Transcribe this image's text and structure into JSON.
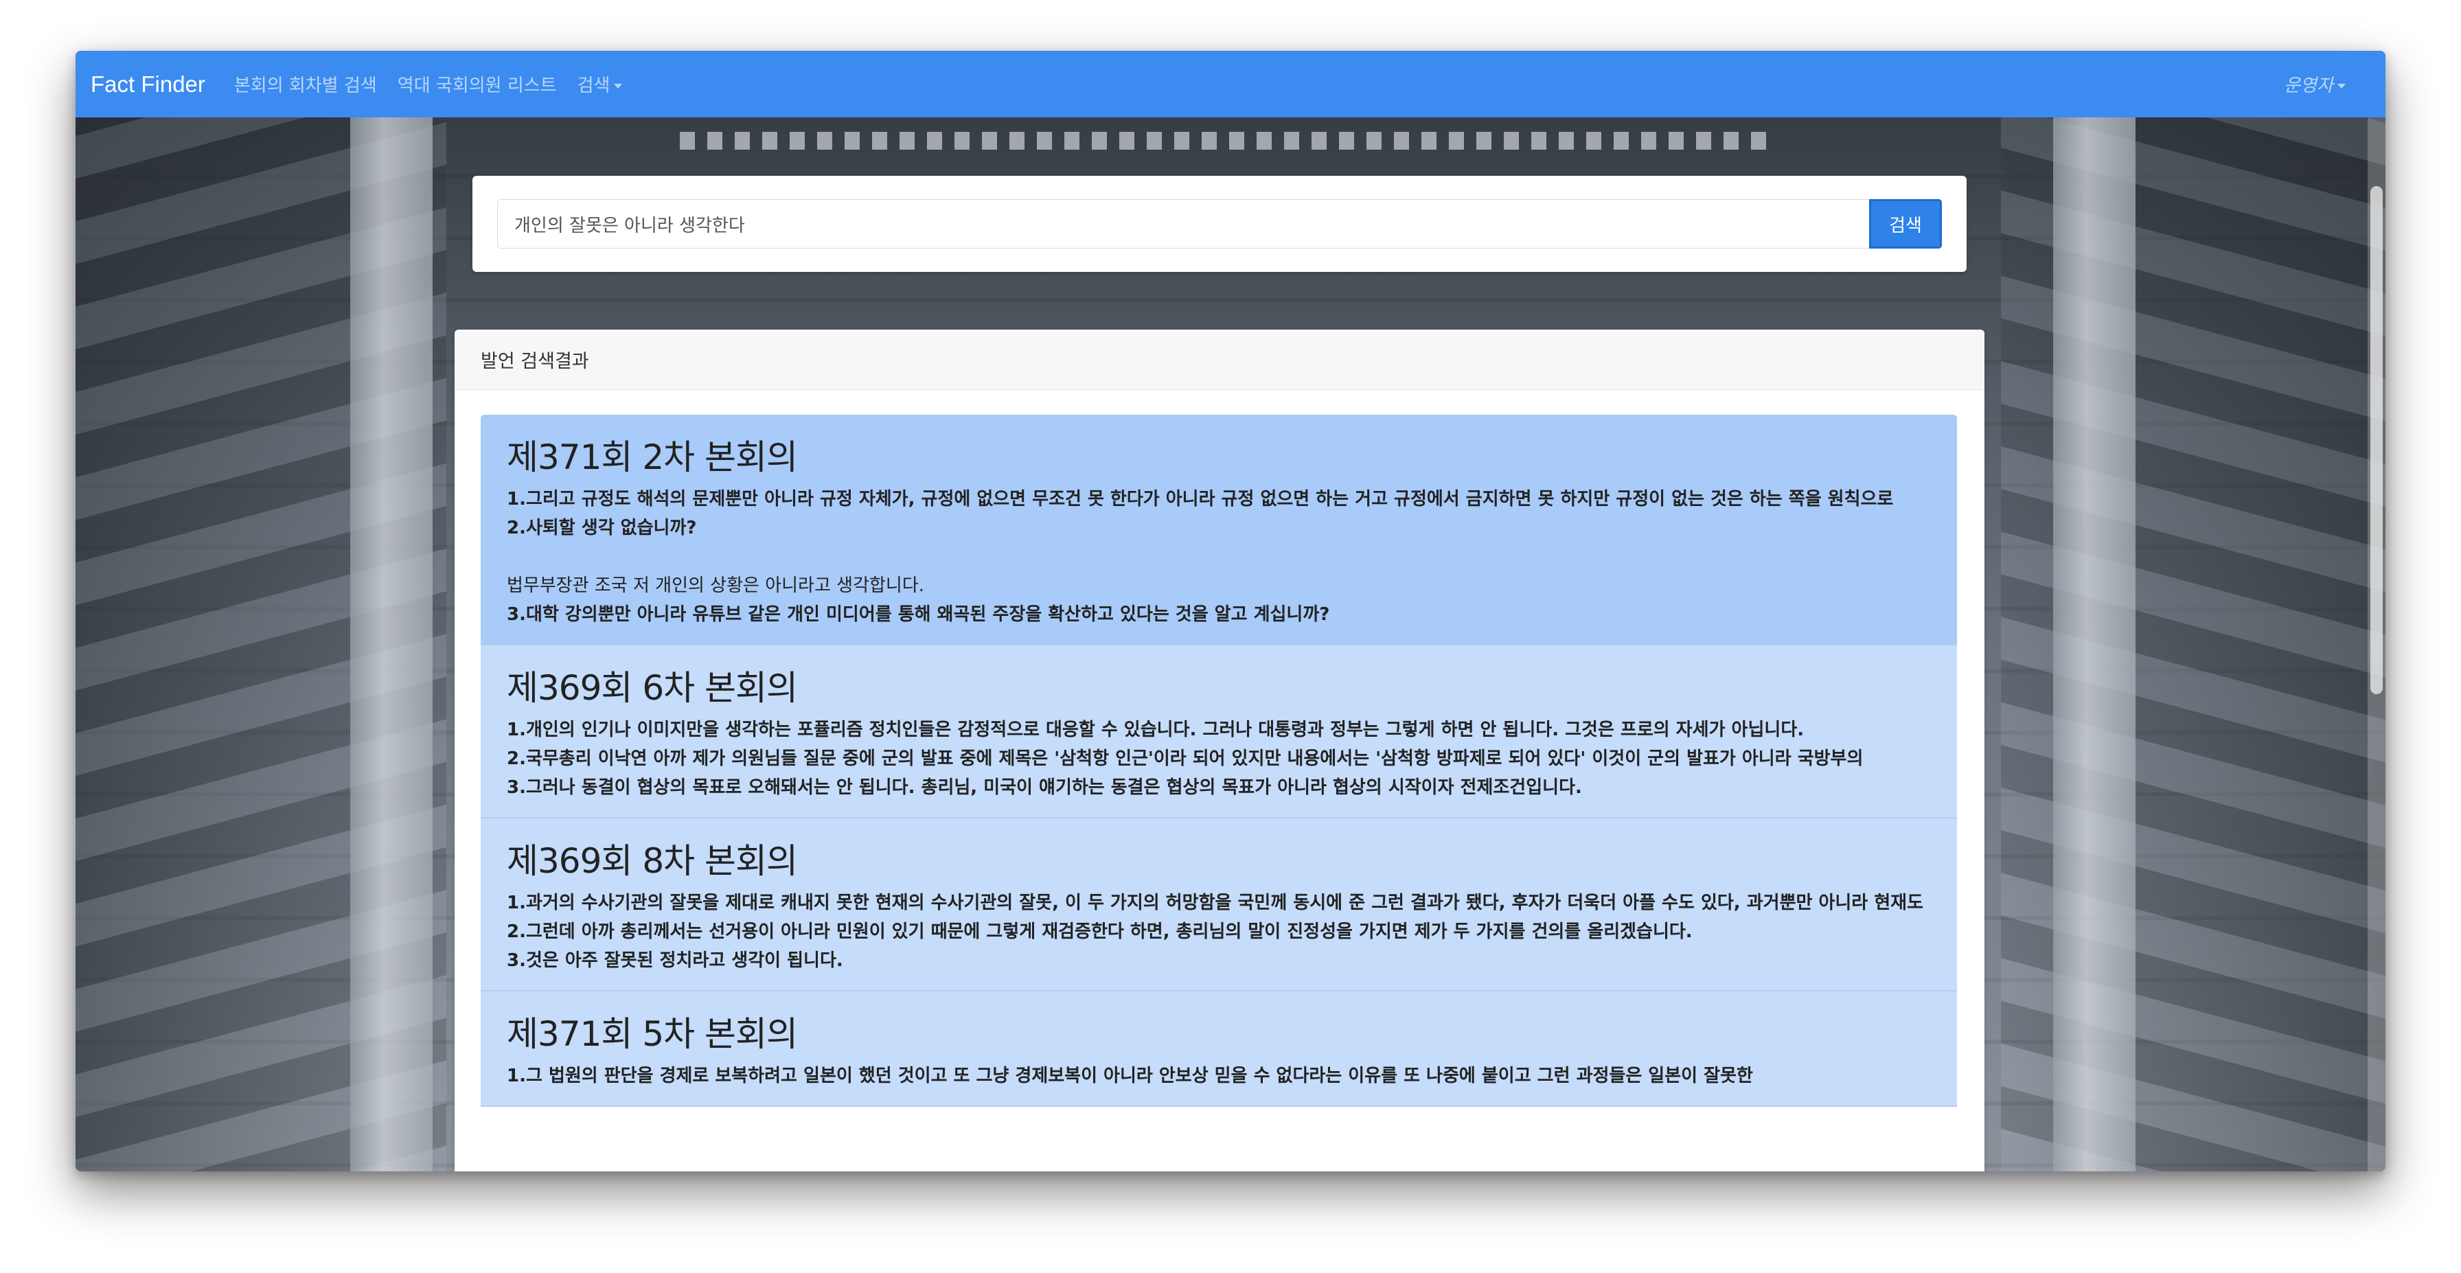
{
  "navbar": {
    "brand": "Fact Finder",
    "links": [
      "본회의 회차별 검색",
      "역대 국회의원 리스트",
      "검색"
    ],
    "user": "운영자"
  },
  "search": {
    "value": "개인의 잘못은 아니라 생각한다",
    "button_label": "검색"
  },
  "results": {
    "header": "발언 검색결과",
    "items": [
      {
        "title": "제371회 2차 본회의",
        "lines": [
          {
            "text": "1.그리고 규정도 해석의 문제뿐만 아니라 규정 자체가, 규정에 없으면 무조건 못 한다가 아니라 규정 없으면 하는 거고 규정에서 금지하면 못 하지만 규정이 없는 것은 하는 쪽을 원칙으로",
            "bold": true
          },
          {
            "text": "2.사퇴할 생각 없습니까?",
            "bold": true
          },
          {
            "text": "",
            "bold": false
          },
          {
            "text": "법무부장관 조국 저 개인의 상황은 아니라고 생각합니다.",
            "bold": false
          },
          {
            "text": "3.대학 강의뿐만 아니라 유튜브 같은 개인 미디어를 통해 왜곡된 주장을 확산하고 있다는 것을 알고 계십니까?",
            "bold": true
          }
        ]
      },
      {
        "title": "제369회 6차 본회의",
        "lines": [
          {
            "text": "1.개인의 인기나 이미지만을 생각하는 포퓰리즘 정치인들은 감정적으로 대응할 수 있습니다. 그러나 대통령과 정부는 그렇게 하면 안 됩니다. 그것은 프로의 자세가 아닙니다.",
            "bold": true
          },
          {
            "text": "2.국무총리 이낙연 아까 제가 의원님들 질문 중에 군의 발표 중에 제목은 '삼척항 인근'이라 되어 있지만 내용에서는 '삼척항 방파제로 되어 있다' 이것이 군의 발표가 아니라 국방부의",
            "bold": true
          },
          {
            "text": "3.그러나 동결이 협상의 목표로 오해돼서는 안 됩니다. 총리님, 미국이 얘기하는 동결은 협상의 목표가 아니라 협상의 시작이자 전제조건입니다.",
            "bold": true
          }
        ]
      },
      {
        "title": "제369회 8차 본회의",
        "lines": [
          {
            "text": "1.과거의 수사기관의 잘못을 제대로 캐내지 못한 현재의 수사기관의 잘못, 이 두 가지의 허망함을 국민께 동시에 준 그런 결과가 됐다, 후자가 더욱더 아플 수도 있다, 과거뿐만 아니라 현재도",
            "bold": true
          },
          {
            "text": "2.그런데 아까 총리께서는 선거용이 아니라 민원이 있기 때문에 그렇게 재검증한다 하면, 총리님의 말이 진정성을 가지면 제가 두 가지를 건의를 올리겠습니다.",
            "bold": true
          },
          {
            "text": "3.것은 아주 잘못된 정치라고 생각이 됩니다.",
            "bold": true
          }
        ]
      },
      {
        "title": "제371회 5차 본회의",
        "lines": [
          {
            "text": "1.그 법원의 판단을 경제로 보복하려고 일본이 했던 것이고 또 그냥 경제보복이 아니라 안보상 믿을 수 없다라는 이유를 또 나중에 붙이고 그런 과정들은 일본이 잘못한",
            "bold": true
          }
        ]
      }
    ]
  }
}
